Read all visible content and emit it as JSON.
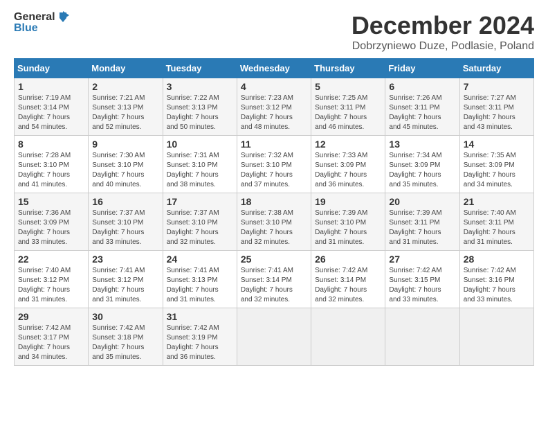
{
  "logo": {
    "text_general": "General",
    "text_blue": "Blue"
  },
  "title": "December 2024",
  "subtitle": "Dobrzyniewo Duze, Podlasie, Poland",
  "headers": [
    "Sunday",
    "Monday",
    "Tuesday",
    "Wednesday",
    "Thursday",
    "Friday",
    "Saturday"
  ],
  "weeks": [
    [
      {
        "day": "1",
        "sunrise": "7:19 AM",
        "sunset": "3:14 PM",
        "daylight": "7 hours and 54 minutes."
      },
      {
        "day": "2",
        "sunrise": "7:21 AM",
        "sunset": "3:13 PM",
        "daylight": "7 hours and 52 minutes."
      },
      {
        "day": "3",
        "sunrise": "7:22 AM",
        "sunset": "3:13 PM",
        "daylight": "7 hours and 50 minutes."
      },
      {
        "day": "4",
        "sunrise": "7:23 AM",
        "sunset": "3:12 PM",
        "daylight": "7 hours and 48 minutes."
      },
      {
        "day": "5",
        "sunrise": "7:25 AM",
        "sunset": "3:11 PM",
        "daylight": "7 hours and 46 minutes."
      },
      {
        "day": "6",
        "sunrise": "7:26 AM",
        "sunset": "3:11 PM",
        "daylight": "7 hours and 45 minutes."
      },
      {
        "day": "7",
        "sunrise": "7:27 AM",
        "sunset": "3:11 PM",
        "daylight": "7 hours and 43 minutes."
      }
    ],
    [
      {
        "day": "8",
        "sunrise": "7:28 AM",
        "sunset": "3:10 PM",
        "daylight": "7 hours and 41 minutes."
      },
      {
        "day": "9",
        "sunrise": "7:30 AM",
        "sunset": "3:10 PM",
        "daylight": "7 hours and 40 minutes."
      },
      {
        "day": "10",
        "sunrise": "7:31 AM",
        "sunset": "3:10 PM",
        "daylight": "7 hours and 38 minutes."
      },
      {
        "day": "11",
        "sunrise": "7:32 AM",
        "sunset": "3:10 PM",
        "daylight": "7 hours and 37 minutes."
      },
      {
        "day": "12",
        "sunrise": "7:33 AM",
        "sunset": "3:09 PM",
        "daylight": "7 hours and 36 minutes."
      },
      {
        "day": "13",
        "sunrise": "7:34 AM",
        "sunset": "3:09 PM",
        "daylight": "7 hours and 35 minutes."
      },
      {
        "day": "14",
        "sunrise": "7:35 AM",
        "sunset": "3:09 PM",
        "daylight": "7 hours and 34 minutes."
      }
    ],
    [
      {
        "day": "15",
        "sunrise": "7:36 AM",
        "sunset": "3:09 PM",
        "daylight": "7 hours and 33 minutes."
      },
      {
        "day": "16",
        "sunrise": "7:37 AM",
        "sunset": "3:10 PM",
        "daylight": "7 hours and 33 minutes."
      },
      {
        "day": "17",
        "sunrise": "7:37 AM",
        "sunset": "3:10 PM",
        "daylight": "7 hours and 32 minutes."
      },
      {
        "day": "18",
        "sunrise": "7:38 AM",
        "sunset": "3:10 PM",
        "daylight": "7 hours and 32 minutes."
      },
      {
        "day": "19",
        "sunrise": "7:39 AM",
        "sunset": "3:10 PM",
        "daylight": "7 hours and 31 minutes."
      },
      {
        "day": "20",
        "sunrise": "7:39 AM",
        "sunset": "3:11 PM",
        "daylight": "7 hours and 31 minutes."
      },
      {
        "day": "21",
        "sunrise": "7:40 AM",
        "sunset": "3:11 PM",
        "daylight": "7 hours and 31 minutes."
      }
    ],
    [
      {
        "day": "22",
        "sunrise": "7:40 AM",
        "sunset": "3:12 PM",
        "daylight": "7 hours and 31 minutes."
      },
      {
        "day": "23",
        "sunrise": "7:41 AM",
        "sunset": "3:12 PM",
        "daylight": "7 hours and 31 minutes."
      },
      {
        "day": "24",
        "sunrise": "7:41 AM",
        "sunset": "3:13 PM",
        "daylight": "7 hours and 31 minutes."
      },
      {
        "day": "25",
        "sunrise": "7:41 AM",
        "sunset": "3:14 PM",
        "daylight": "7 hours and 32 minutes."
      },
      {
        "day": "26",
        "sunrise": "7:42 AM",
        "sunset": "3:14 PM",
        "daylight": "7 hours and 32 minutes."
      },
      {
        "day": "27",
        "sunrise": "7:42 AM",
        "sunset": "3:15 PM",
        "daylight": "7 hours and 33 minutes."
      },
      {
        "day": "28",
        "sunrise": "7:42 AM",
        "sunset": "3:16 PM",
        "daylight": "7 hours and 33 minutes."
      }
    ],
    [
      {
        "day": "29",
        "sunrise": "7:42 AM",
        "sunset": "3:17 PM",
        "daylight": "7 hours and 34 minutes."
      },
      {
        "day": "30",
        "sunrise": "7:42 AM",
        "sunset": "3:18 PM",
        "daylight": "7 hours and 35 minutes."
      },
      {
        "day": "31",
        "sunrise": "7:42 AM",
        "sunset": "3:19 PM",
        "daylight": "7 hours and 36 minutes."
      },
      null,
      null,
      null,
      null
    ]
  ],
  "labels": {
    "sunrise": "Sunrise:",
    "sunset": "Sunset:",
    "daylight": "Daylight:"
  }
}
